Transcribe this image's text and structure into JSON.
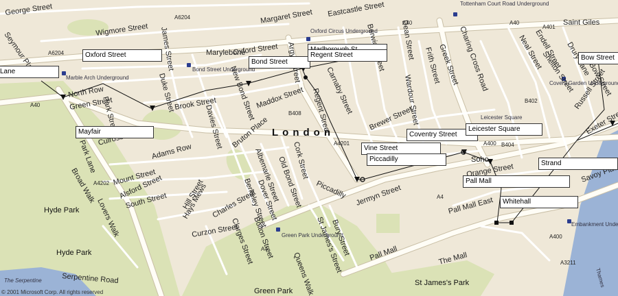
{
  "colors": {
    "background": "#efe8d8",
    "park": "#dbe2b6",
    "water": "#9bb3d6",
    "road": "#fffdf6",
    "road_edge": "#c9bfa6",
    "route": "#111111"
  },
  "city": "London",
  "copyright": "© 2001 Microsoft Corp. All rights reserved",
  "streets": [
    "George Street",
    "Seymour Place",
    "Wigmore Street",
    "James Street",
    "A6204",
    "Marylebone",
    "Oxford Street",
    "Margaret Street",
    "Eastcastle Street",
    "A40",
    "A6204",
    "Tottenham Court Road Underground",
    "Saint Giles",
    "A401",
    "Dean Street",
    "Charing Cross Road",
    "Greek Street",
    "Frith Street",
    "Wardour Street",
    "Berwick Street",
    "Neal Street",
    "Endell Street",
    "Shelton Street",
    "Bow Street",
    "Drury Lane",
    "Russell Street",
    "North Row",
    "Green Street",
    "Park Street",
    "Brook Street",
    "Duke Street",
    "Davies Street",
    "Maddox Street",
    "New Bond Street",
    "Regent Street",
    "Carnaby Street",
    "Brewer Street",
    "Argyll Street",
    "B408",
    "Curzon Street",
    "Park Lane",
    "Culross Street",
    "Adams Row",
    "Mount Street",
    "Alsford Street",
    "South Street",
    "Hill Street",
    "Hays Mews",
    "Charles Street",
    "Bruton Place",
    "Albemarle Street",
    "Dover Street",
    "Berkeley Street",
    "Cork Street",
    "Old Bond Street",
    "Piccadilly",
    "Jermyn Street",
    "Bury Street",
    "St James's Street",
    "Pall Mall",
    "The Mall",
    "Pall Mall East",
    "Orange Street",
    "Savoy Place",
    "Exeter Street",
    "A4",
    "A400",
    "A404",
    "A4201",
    "A4202",
    "B402",
    "A3211",
    "Broad Walk",
    "Lovers Walk",
    "Serpentine Road",
    "Queens Walk",
    "Clarges Street",
    "Bolton Street",
    "Green Park",
    "St James's Park",
    "Hyde Park",
    "The Serpentine",
    "Thames",
    "Soho"
  ],
  "stations": [
    "Marble Arch Underground",
    "Bond Street Underground",
    "Oxford Circus Underground",
    "Green Park Underground",
    "Covent Garden Underground",
    "Leicester Square",
    "Embankment Underground",
    "Tottenham Court Road Underground"
  ],
  "callouts": [
    "Lane",
    "Oxford Street",
    "Bond Street",
    "Marlborough St",
    "Regent Street",
    "Mayfair",
    "Vine Street",
    "Piccadilly",
    "Coventry Street",
    "Leicester Square",
    "Strand",
    "Pall Mall",
    "Whitehall",
    "Bow Street"
  ],
  "labels": {
    "george": "George Street",
    "seymour": "Seymour Place",
    "wigmore": "Wigmore Street",
    "james": "James Street",
    "marylebone": "Marylebone",
    "oxford": "Oxford Street",
    "margaret": "Margaret Street",
    "eastcastle": "Eastcastle Street",
    "tcr": "Tottenham Court Road Underground",
    "stgiles": "Saint Giles",
    "dean": "Dean Street",
    "charing": "Charing Cross Road",
    "greek": "Greek Street",
    "frith": "Frith Street",
    "wardour": "Wardour Street",
    "berwick": "Berwick Street",
    "neal": "Neal Street",
    "endell": "Endell Street",
    "shelton": "Shelton Street",
    "drury": "Drury Lane",
    "russell": "Russell Street",
    "northrow": "North Row",
    "green": "Green Street",
    "park": "Park Street",
    "brook": "Brook Street",
    "duke": "Duke Street",
    "davies": "Davies Street",
    "maddox": "Maddox Street",
    "newbond": "New Bond Street",
    "regent": "Regent Street",
    "carnaby": "Carnaby Street",
    "brewer": "Brewer Street",
    "argyll": "Argyll Street",
    "culross": "Culross Street",
    "adams": "Adams Row",
    "mount": "Mount Street",
    "alsford": "Alsford Street",
    "south": "South Street",
    "hill": "Hill Street",
    "hays": "Hays Mews",
    "charles": "Charles Street",
    "bruton": "Bruton Place",
    "albemarle": "Albemarle Street",
    "dover": "Dover Street",
    "berkeley": "Berkeley Street",
    "cork": "Cork Street",
    "oldbond": "Old Bond Street",
    "piccadilly": "Piccadilly",
    "jermyn": "Jermyn Street",
    "bury": "Bury Street",
    "stjames": "St James's Street",
    "pallmall": "Pall Mall",
    "themall": "The Mall",
    "pallmalleast": "Pall Mall East",
    "orange": "Orange Street",
    "savoy": "Savoy Place",
    "exeter": "Exeter Street",
    "curzon": "Curzon Street",
    "parklane": "Park Lane",
    "broadwalk": "Broad Walk",
    "lovers": "Lovers Walk",
    "serpentine": "Serpentine Road",
    "queens": "Queens Walk",
    "clarges": "Clarges Street",
    "bolton": "Bolton Street",
    "greenpark": "Green Park",
    "stjamespark": "St James's Park",
    "hydepark1": "Hyde Park",
    "hydepark2": "Hyde Park",
    "theserp": "The Serpentine",
    "thames": "Thames",
    "soho": "Soho",
    "bowst": "Bow Street",
    "a40a": "A40",
    "a40b": "A40",
    "a40c": "A40",
    "a6204a": "A6204",
    "a6204b": "A6204",
    "a401": "A401",
    "b402": "B402",
    "b404": "B404",
    "a4201": "A4201",
    "a4202": "A4202",
    "a4a": "A4",
    "a4b": "A4",
    "a400a": "A400",
    "a400b": "A400",
    "a3211": "A3211",
    "b408": "B408",
    "marblearch_ug": "Marble Arch Underground",
    "bond_ug": "Bond Street Underground",
    "oxc_ug": "Oxford Circus Underground",
    "gp_ug": "Green Park Underground",
    "cg_ug": "Covent Garden Underground",
    "ls_ug": "Leicester Square",
    "emb_ug": "Embankment Underground"
  },
  "callout_text": {
    "lane": "Lane",
    "oxford": "Oxford Street",
    "bond": "Bond Street",
    "marlborough": "Marlborough St",
    "regent": "Regent Street",
    "mayfair": "Mayfair",
    "vine": "Vine Street",
    "piccadilly": "Piccadilly",
    "coventry": "Coventry Street",
    "leicester": "Leicester Square",
    "strand": "Strand",
    "pallmall": "Pall Mall",
    "whitehall": "Whitehall",
    "bow": "Bow Street"
  }
}
